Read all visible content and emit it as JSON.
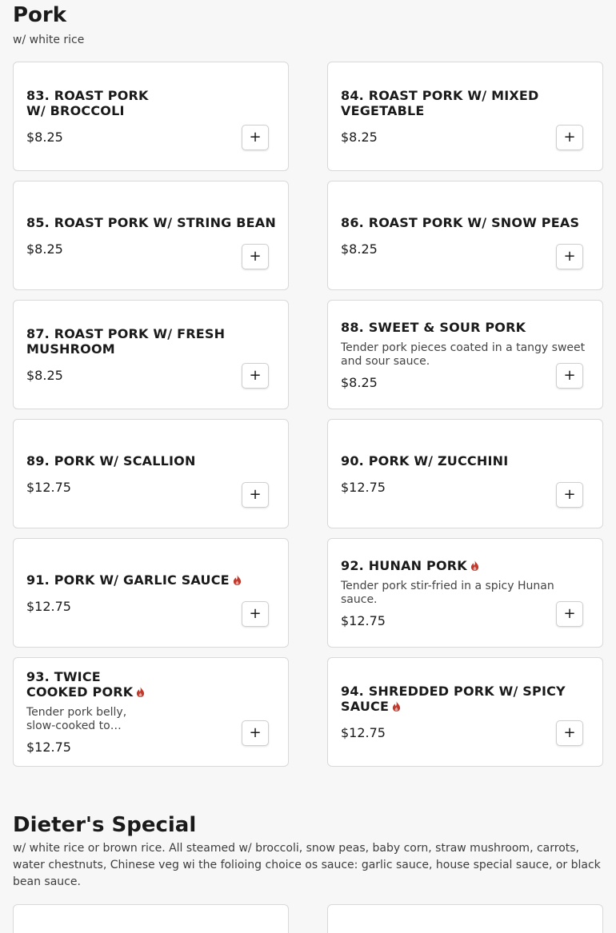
{
  "sections": [
    {
      "title": "Pork",
      "description": "w/ white rice",
      "items": [
        {
          "name": "83. ROAST PORK W/ BROCCOLI",
          "price": "$8.25",
          "spicy": false
        },
        {
          "name": "84. ROAST PORK W/ MIXED VEGETABLE",
          "price": "$8.25",
          "spicy": false
        },
        {
          "name": "85. ROAST PORK W/ STRING BEAN",
          "price": "$8.25",
          "spicy": false
        },
        {
          "name": "86. ROAST PORK W/ SNOW PEAS",
          "price": "$8.25",
          "spicy": false
        },
        {
          "name": "87. ROAST PORK W/ FRESH MUSHROOM",
          "price": "$8.25",
          "spicy": false
        },
        {
          "name": "88. SWEET & SOUR PORK",
          "description": "Tender pork pieces coated in a tangy sweet and sour sauce.",
          "price": "$8.25",
          "spicy": false
        },
        {
          "name": "89. PORK W/ SCALLION",
          "price": "$12.75",
          "spicy": false
        },
        {
          "name": "90. PORK W/ ZUCCHINI",
          "price": "$12.75",
          "spicy": false
        },
        {
          "name": "91. PORK W/ GARLIC SAUCE",
          "price": "$12.75",
          "spicy": true
        },
        {
          "name": "92. HUNAN PORK",
          "description": "Tender pork stir-fried in a spicy Hunan sauce.",
          "price": "$12.75",
          "spicy": true
        },
        {
          "name": "93. TWICE COOKED PORK",
          "description": "Tender pork belly, slow-cooked to…",
          "price": "$12.75",
          "spicy": true
        },
        {
          "name": "94. SHREDDED PORK W/ SPICY SAUCE",
          "price": "$12.75",
          "spicy": true
        }
      ]
    },
    {
      "title": "Dieter's Special",
      "description": "w/ white rice or brown rice. All steamed w/ broccoli, snow peas, baby corn, straw mushroom, carrots, water chestnuts, Chinese veg wi the folioing choice os sauce: garlic sauce, house special sauce, or black bean sauce."
    }
  ],
  "add_button_label": "+",
  "icons": {
    "spicy": "flame-icon",
    "add": "plus-icon"
  },
  "colors": {
    "spicy": "#c0392b",
    "card_border": "#d9d9d9"
  }
}
